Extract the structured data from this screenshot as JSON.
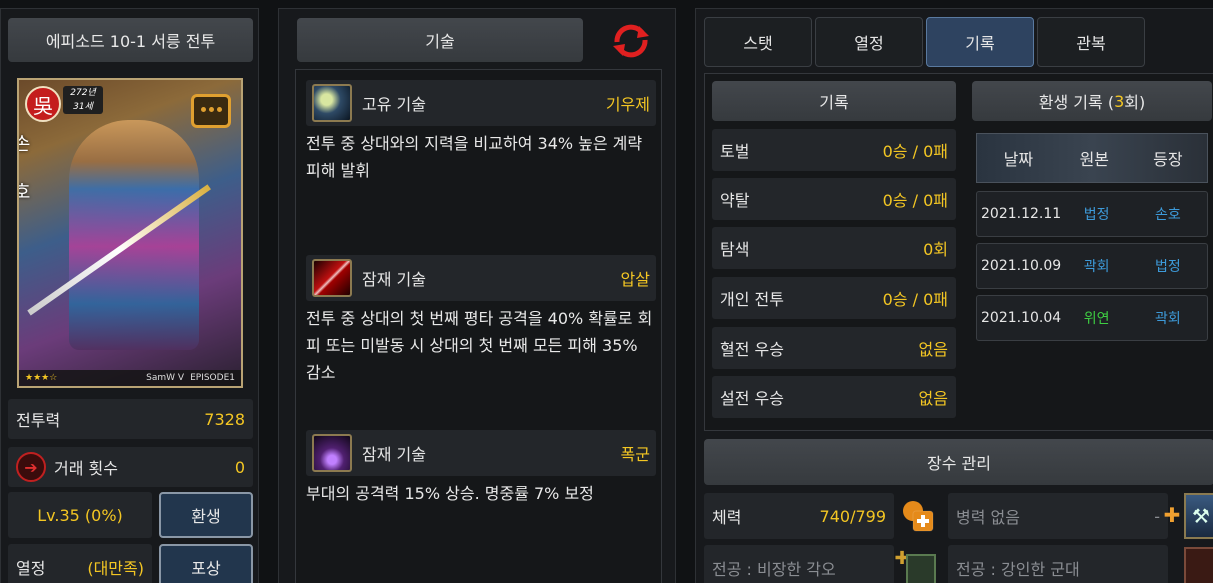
{
  "left": {
    "episode_title": "에피소드 10-1 서릉 전투",
    "portrait": {
      "faction": "吳",
      "age_line1": "272년",
      "age_line2": "31세",
      "name_vertical": "손호",
      "footer_brand": "SamW V",
      "footer_episode": "EPISODE1"
    },
    "combat_power_label": "전투력",
    "combat_power_value": "7328",
    "trade_label": "거래 횟수",
    "trade_value": "0",
    "level_text": "Lv.35 (0%)",
    "reincarnate_button": "환생",
    "passion_label": "열정",
    "passion_value": "(대만족)",
    "reward_button": "포상"
  },
  "middle": {
    "header": "기술",
    "skills": [
      {
        "type": "고유 기술",
        "name": "기우제",
        "desc": "전투 중 상대와의 지력을 비교하여 34% 높은 계략 피해 발휘"
      },
      {
        "type": "잠재 기술",
        "name": "압살",
        "desc": "전투 중 상대의 첫 번째 평타 공격을 40% 확률로 회피 또는 미발동 시 상대의 첫 번째 모든 피해 35% 감소"
      },
      {
        "type": "잠재 기술",
        "name": "폭군",
        "desc": "부대의 공격력 15% 상승. 명중률 7% 보정"
      }
    ]
  },
  "right": {
    "tabs": [
      "스탯",
      "열정",
      "기록",
      "관복"
    ],
    "active_tab": "기록",
    "record_header": "기록",
    "records": [
      {
        "label": "토벌",
        "value": "0승 / 0패"
      },
      {
        "label": "약탈",
        "value": "0승 / 0패"
      },
      {
        "label": "탐색",
        "value": "0회"
      },
      {
        "label": "개인 전투",
        "value": "0승 / 0패"
      },
      {
        "label": "혈전 우승",
        "value": "없음"
      },
      {
        "label": "설전 우승",
        "value": "없음"
      }
    ],
    "rebirth_header_prefix": "환생 기록 (",
    "rebirth_count": "3",
    "rebirth_header_suffix": "회)",
    "history_columns": [
      "날짜",
      "원본",
      "등장"
    ],
    "history": [
      {
        "date": "2021.12.11",
        "origin": "법정",
        "appear": "손호"
      },
      {
        "date": "2021.10.09",
        "origin": "곽회",
        "appear": "법정"
      },
      {
        "date": "2021.10.04",
        "origin": "위연",
        "appear": "곽회"
      }
    ],
    "manage_header": "장수 관리",
    "hp_label": "체력",
    "hp_value": "740/799",
    "troops_text": "병력 없음",
    "troops_dash": "-",
    "merit1": "전공 : 비장한 각오",
    "merit2": "전공 : 강인한 군대"
  },
  "colors": {
    "accent_yellow": "#f3c623",
    "blue": "#3d9ad9",
    "green": "#3ecf42",
    "active_tab": "#2e4360"
  }
}
